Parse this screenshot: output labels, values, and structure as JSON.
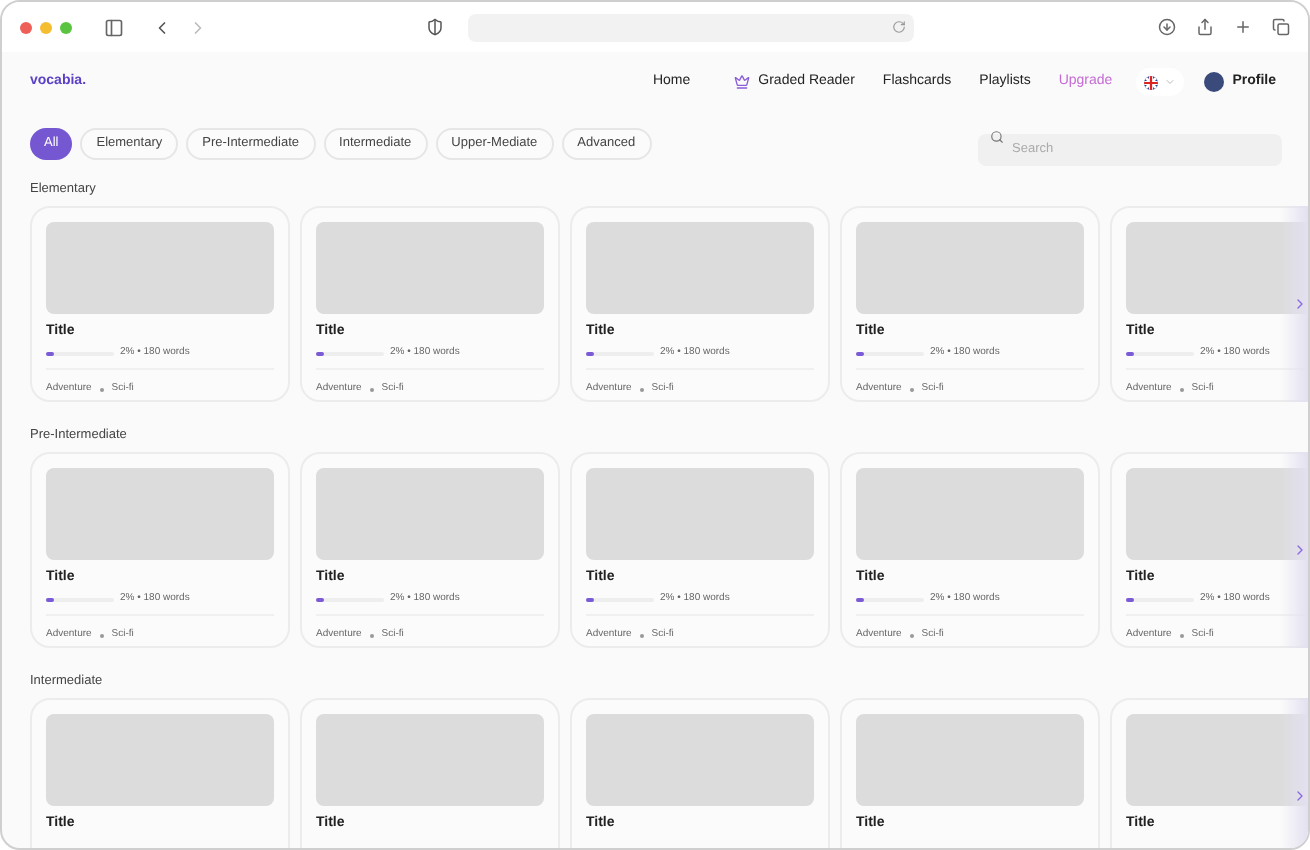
{
  "nav": {
    "logo": "vocabia.",
    "links": [
      {
        "label": "Home",
        "kind": "link"
      },
      {
        "label": "Graded Reader",
        "kind": "crown"
      },
      {
        "label": "Flashcards",
        "kind": "link"
      },
      {
        "label": "Playlists",
        "kind": "link"
      },
      {
        "label": "Upgrade",
        "kind": "upgrade"
      }
    ],
    "profile": "Profile"
  },
  "filters": [
    {
      "label": "All",
      "selected": true
    },
    {
      "label": "Elementary",
      "selected": false
    },
    {
      "label": "Pre-Intermediate",
      "selected": false
    },
    {
      "label": "Intermediate",
      "selected": false
    },
    {
      "label": "Upper-Mediate",
      "selected": false
    },
    {
      "label": "Advanced",
      "selected": false
    }
  ],
  "search": {
    "placeholder": "Search"
  },
  "sections": [
    {
      "title": "Elementary",
      "cards": [
        {
          "title": "Title",
          "level": 0.12,
          "reading": "2% • 180 words",
          "tags": [
            "Adventure",
            "Sci-fi"
          ]
        },
        {
          "title": "Title",
          "level": 0.12,
          "reading": "2% • 180 words",
          "tags": [
            "Adventure",
            "Sci-fi"
          ]
        },
        {
          "title": "Title",
          "level": 0.12,
          "reading": "2% • 180 words",
          "tags": [
            "Adventure",
            "Sci-fi"
          ]
        },
        {
          "title": "Title",
          "level": 0.12,
          "reading": "2% • 180 words",
          "tags": [
            "Adventure",
            "Sci-fi"
          ]
        },
        {
          "title": "Title",
          "level": 0.12,
          "reading": "2% • 180 words",
          "tags": [
            "Adventure",
            "Sci-fi"
          ]
        }
      ]
    },
    {
      "title": "Pre-Intermediate",
      "cards": [
        {
          "title": "Title",
          "level": 0.12,
          "reading": "2% • 180 words",
          "tags": [
            "Adventure",
            "Sci-fi"
          ]
        },
        {
          "title": "Title",
          "level": 0.12,
          "reading": "2% • 180 words",
          "tags": [
            "Adventure",
            "Sci-fi"
          ]
        },
        {
          "title": "Title",
          "level": 0.12,
          "reading": "2% • 180 words",
          "tags": [
            "Adventure",
            "Sci-fi"
          ]
        },
        {
          "title": "Title",
          "level": 0.12,
          "reading": "2% • 180 words",
          "tags": [
            "Adventure",
            "Sci-fi"
          ]
        },
        {
          "title": "Title",
          "level": 0.12,
          "reading": "2% • 180 words",
          "tags": [
            "Adventure",
            "Sci-fi"
          ]
        }
      ]
    },
    {
      "title": "Intermediate",
      "cards": [
        {
          "title": "Title"
        },
        {
          "title": "Title"
        },
        {
          "title": "Title"
        },
        {
          "title": "Title"
        },
        {
          "title": "Title"
        }
      ]
    }
  ]
}
